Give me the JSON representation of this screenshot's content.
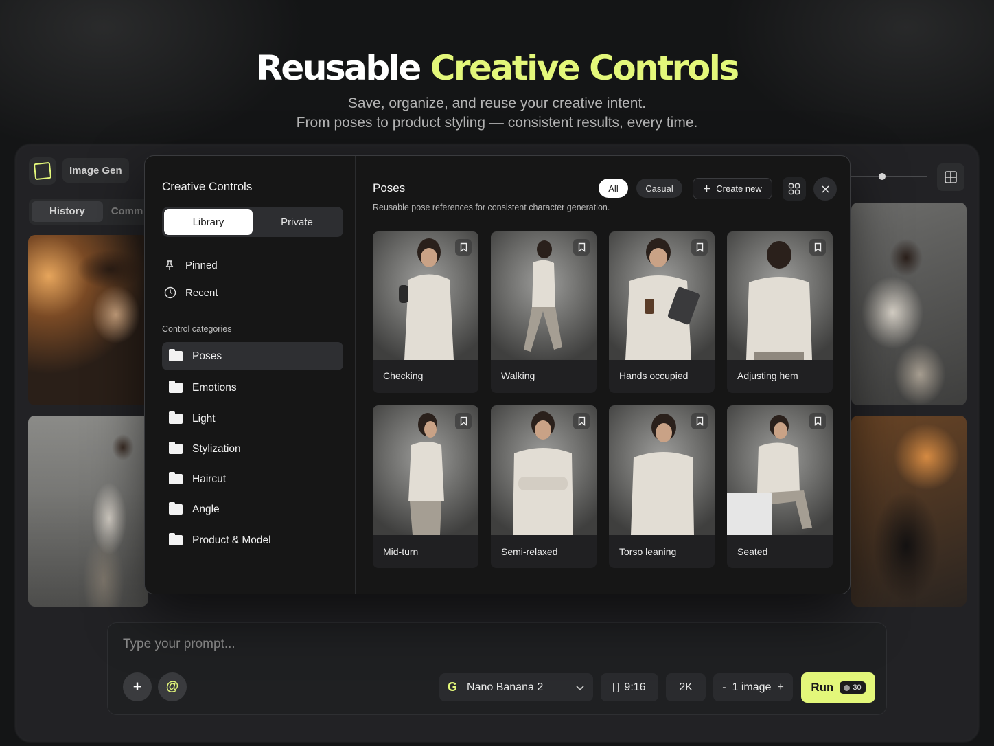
{
  "hero": {
    "title_main": "Reusable",
    "title_accent": "Creative Controls",
    "subtitle_line1": "Save, organize, and reuse your creative intent.",
    "subtitle_line2": "From poses to product styling — consistent results, every time."
  },
  "app": {
    "title": "Image Gen",
    "tabs": [
      "History",
      "Comm"
    ]
  },
  "sidebar": {
    "title": "Creative Controls",
    "segments": [
      "Library",
      "Private"
    ],
    "active_segment": "Library",
    "quick_items": [
      {
        "label": "Pinned",
        "icon": "pin-icon"
      },
      {
        "label": "Recent",
        "icon": "clock-icon"
      }
    ],
    "categories_heading": "Control categories",
    "categories": [
      "Poses",
      "Emotions",
      "Light",
      "Stylization",
      "Haircut",
      "Angle",
      "Product & Model"
    ],
    "active_category": "Poses"
  },
  "main": {
    "title": "Poses",
    "description": "Reusable pose references for consistent character generation.",
    "filters": [
      "All",
      "Casual"
    ],
    "active_filter": "All",
    "create_label": "Create new",
    "poses": [
      "Checking",
      "Walking",
      "Hands occupied",
      "Adjusting hem",
      "Mid-turn",
      "Semi-relaxed",
      "Torso leaning",
      "Seated"
    ]
  },
  "prompt": {
    "placeholder": "Type your prompt...",
    "model_icon": "G",
    "model": "Nano Banana 2",
    "aspect_ratio": "9:16",
    "resolution": "2K",
    "count_minus": "-",
    "count_label": "1 image",
    "count_plus": "+",
    "run_label": "Run",
    "run_cost": "30"
  },
  "colors": {
    "accent": "#e3f77a",
    "background": "#161616",
    "panel": "#2e2f32"
  }
}
